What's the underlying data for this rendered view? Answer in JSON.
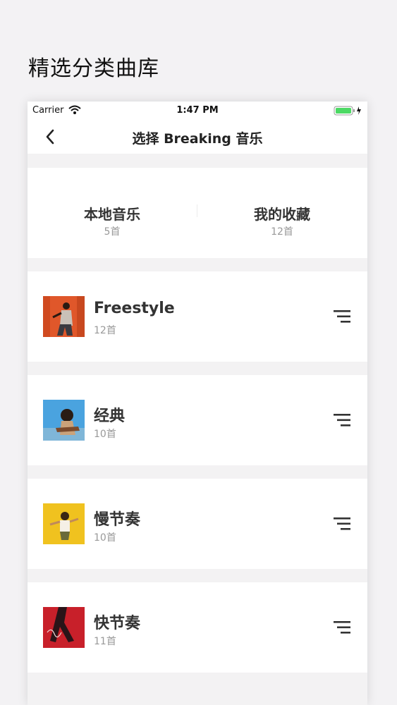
{
  "page": {
    "heading": "精选分类曲库"
  },
  "status_bar": {
    "carrier": "Carrier",
    "time": "1:47 PM",
    "battery_color": "#4cd964"
  },
  "nav": {
    "title": "选择 Breaking 音乐",
    "back_icon": "chevron-left-icon"
  },
  "sources": [
    {
      "label": "本地音乐",
      "count": "5首"
    },
    {
      "label": "我的收藏",
      "count": "12首"
    }
  ],
  "categories": [
    {
      "name": "Freestyle",
      "count": "12首",
      "cover_colors": [
        "#e0572a",
        "#c9c1b8"
      ]
    },
    {
      "name": "经典",
      "count": "10首",
      "cover_colors": [
        "#4aa3df",
        "#caa27a"
      ]
    },
    {
      "name": "慢节奏",
      "count": "10首",
      "cover_colors": [
        "#f0c21f",
        "#b8843a"
      ]
    },
    {
      "name": "快节奏",
      "count": "11首",
      "cover_colors": [
        "#c8202a",
        "#2a1418"
      ]
    }
  ],
  "icons": {
    "row_action": "list-menu-icon",
    "wifi": "wifi-icon",
    "battery": "battery-icon"
  }
}
